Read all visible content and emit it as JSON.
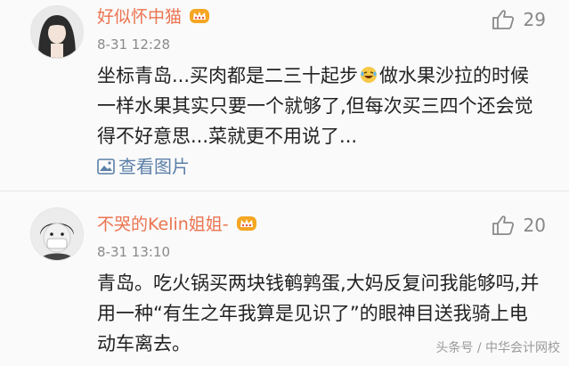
{
  "comments": [
    {
      "username": "好似怀中猫",
      "time": "8-31 12:28",
      "likes": "29",
      "text_before_emoji": "坐标青岛...买肉都是二三十起步",
      "text_after_emoji": "做水果沙拉的时候一样水果其实只要一个就够了,但每次买三四个还会觉得不好意思...菜就更不用说了...",
      "view_pics_label": "查看图片",
      "icons": {
        "avatar": "girl-avatar",
        "badge": "crown-badge-icon",
        "like": "thumbs-up-icon",
        "emoji": "laughing-tears-emoji-icon",
        "pic": "image-icon"
      }
    },
    {
      "username": "不哭的Kelin姐姐-",
      "time": "8-31 13:10",
      "likes": "20",
      "text": "青岛。吃火锅买两块钱鹌鹑蛋,大妈反复问我能够吗,并用一种“有生之年我算是见识了”的眼神目送我骑上电动车离去。",
      "icons": {
        "avatar": "masked-boy-avatar",
        "badge": "crown-badge-icon",
        "like": "thumbs-up-icon"
      }
    }
  ],
  "watermark": "头条号 / 中华会计网校",
  "colors": {
    "username": "#eb7350",
    "link": "#5b7fa8",
    "badge": "#f5a623"
  }
}
